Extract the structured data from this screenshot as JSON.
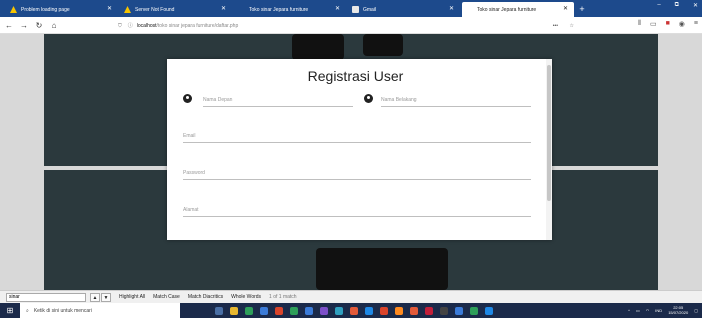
{
  "tabs": [
    {
      "title": "Problem loading page",
      "active": false
    },
    {
      "title": "Server Not Found",
      "active": false
    },
    {
      "title": "Toko sinar Jepara furniture",
      "active": false
    },
    {
      "title": "Gmail",
      "active": false
    },
    {
      "title": "Toko sinar Jepara furniture",
      "active": true
    }
  ],
  "url": {
    "host": "localhost",
    "path": "/toko sinar jepara furniture/daftar.php"
  },
  "modal": {
    "title": "Registrasi User",
    "fields": {
      "first_name": "Nama Depan",
      "last_name": "Nama Belakang",
      "email": "Email",
      "password": "Password",
      "address": "Alamat"
    }
  },
  "find": {
    "query": "sinar",
    "highlight_all": "Highlight All",
    "match_case": "Match Case",
    "match_diacritics": "Match Diacritics",
    "whole_words": "Whole Words",
    "result": "1 of 1 match"
  },
  "taskbar": {
    "search_placeholder": "Ketik di sini untuk mencari",
    "lang": "IND",
    "time": "22:05",
    "date": "15/07/2020"
  },
  "colors": {
    "tabbar": "#1d4a8c",
    "page_panel": "#2b393d",
    "taskbar": "#1b2a4a"
  }
}
